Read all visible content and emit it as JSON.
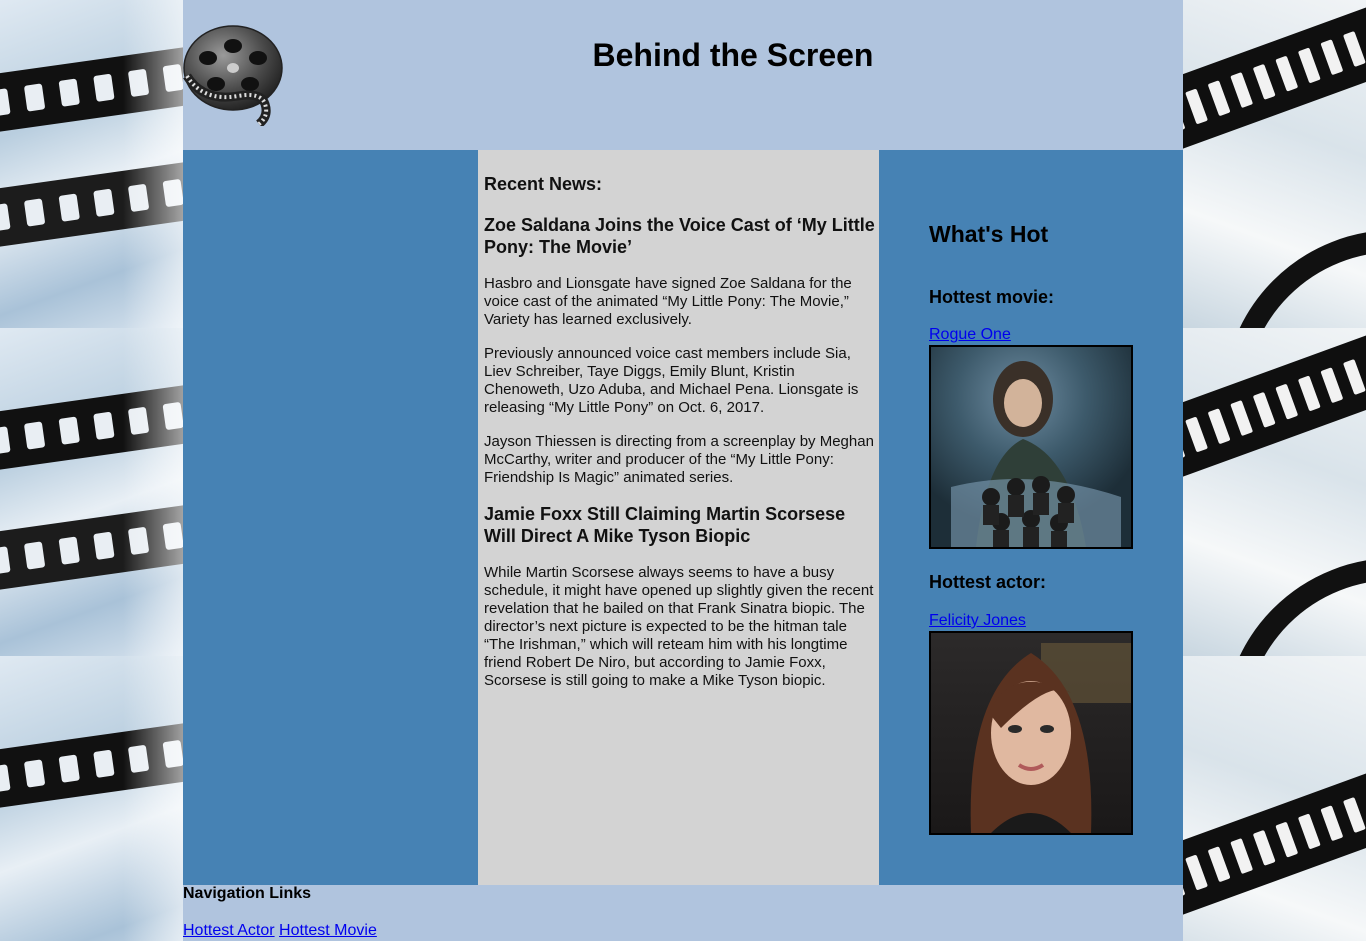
{
  "header": {
    "title": "Behind the Screen"
  },
  "news": {
    "heading": "Recent News:",
    "articles": [
      {
        "title": "Zoe Saldana Joins the Voice Cast of ‘My Little Pony: The Movie’",
        "paragraphs": [
          "Hasbro and Lionsgate have signed Zoe Saldana for the voice cast of the animated “My Little Pony: The Movie,” Variety has learned exclusively.",
          "Previously announced voice cast members include Sia, Liev Schreiber, Taye Diggs, Emily Blunt, Kristin Chenoweth, Uzo Aduba, and Michael Pena. Lionsgate is releasing “My Little Pony” on Oct. 6, 2017.",
          "Jayson Thiessen is directing from a screenplay by Meghan McCarthy, writer and producer of the “My Little Pony: Friendship Is Magic” animated series."
        ]
      },
      {
        "title": "Jamie Foxx Still Claiming Martin Scorsese Will Direct A Mike Tyson Biopic",
        "paragraphs": [
          "While Martin Scorsese always seems to have a busy schedule, it might have opened up slightly given the recent revelation that he bailed on that Frank Sinatra biopic. The director’s next picture is expected to be the hitman tale “The Irishman,” which will reteam him with his longtime friend Robert De Niro, but according to Jamie Foxx, Scorsese is still going to make a Mike Tyson biopic."
        ]
      }
    ]
  },
  "sidebar": {
    "heading": "What's Hot",
    "movie_label": "Hottest movie:",
    "movie_name": "Rogue One",
    "actor_label": "Hottest actor:",
    "actor_name": "Felicity Jones"
  },
  "footer": {
    "heading": "Navigation Links",
    "links": [
      "Hottest Actor",
      "Hottest Movie"
    ]
  },
  "colors": {
    "page_bg": "#b0c4de",
    "side_columns": "#4682b4",
    "content_column": "#d3d3d3",
    "link": "#0000ee"
  },
  "icons": [
    "film-reel-icon"
  ]
}
